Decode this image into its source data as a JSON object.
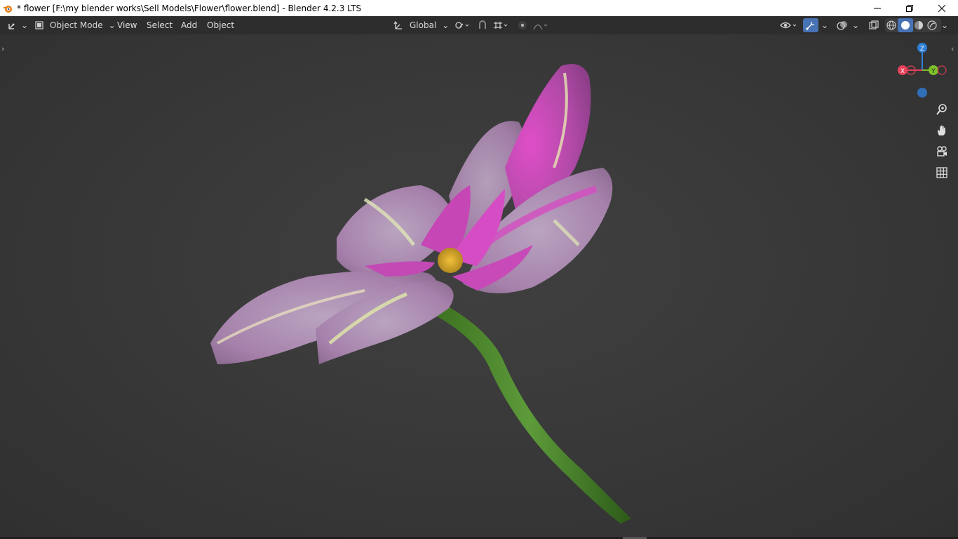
{
  "window": {
    "title": "* flower [F:\\my blender works\\Sell Models\\Flower\\flower.blend] - Blender 4.2.3 LTS",
    "controls": [
      "minimize-icon",
      "restore-icon",
      "close-icon"
    ]
  },
  "header": {
    "editor_type_icon": "axes-editor-icon",
    "mode": {
      "label": "Object Mode",
      "icon": "object-mode-icon"
    },
    "menus": [
      "View",
      "Select",
      "Add",
      "Object"
    ],
    "transform_orientation": {
      "label": "Global",
      "icon": "orientation-icon"
    },
    "right_tools": [
      "pivot-point-icon",
      "snap-icon",
      "snap-increment-icon",
      "proportional-editing-icon",
      "falloff-icon",
      "visibility-icon",
      "gizmo-icon",
      "overlay-icon",
      "xray-icon"
    ],
    "shading_modes": [
      "wireframe",
      "solid",
      "material-preview",
      "rendered"
    ],
    "active_shading": "solid",
    "accent_color": "#4772b3"
  },
  "viewport": {
    "gizmo_axes": {
      "z": "Z",
      "x": "X",
      "y": "Y"
    },
    "axis_colors": {
      "x": "#e8405a",
      "y": "#7ec02a",
      "z": "#2f7fd8"
    },
    "nav_tools": [
      "zoom-icon",
      "hand-pan-icon",
      "camera-icon",
      "perspective-grid-icon"
    ],
    "background_color": "#3a3a3a"
  }
}
